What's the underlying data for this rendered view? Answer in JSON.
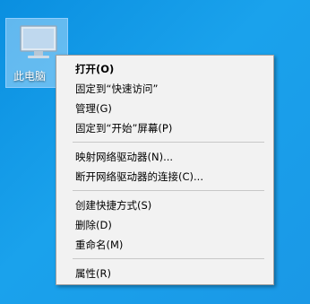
{
  "desktop": {
    "icon_label": "此电脑",
    "icon_name": "this-pc-icon"
  },
  "context_menu": {
    "groups": [
      [
        {
          "label": "打开(O)",
          "bold": true
        },
        {
          "label": "固定到“快速访问”"
        },
        {
          "label": "管理(G)"
        },
        {
          "label": "固定到“开始”屏幕(P)"
        }
      ],
      [
        {
          "label": "映射网络驱动器(N)..."
        },
        {
          "label": "断开网络驱动器的连接(C)..."
        }
      ],
      [
        {
          "label": "创建快捷方式(S)"
        },
        {
          "label": "删除(D)"
        },
        {
          "label": "重命名(M)"
        }
      ],
      [
        {
          "label": "属性(R)"
        }
      ]
    ]
  },
  "colors": {
    "desktop_background": "#0a8fe0",
    "menu_background": "#f2f2f2",
    "menu_text": "#000000"
  }
}
